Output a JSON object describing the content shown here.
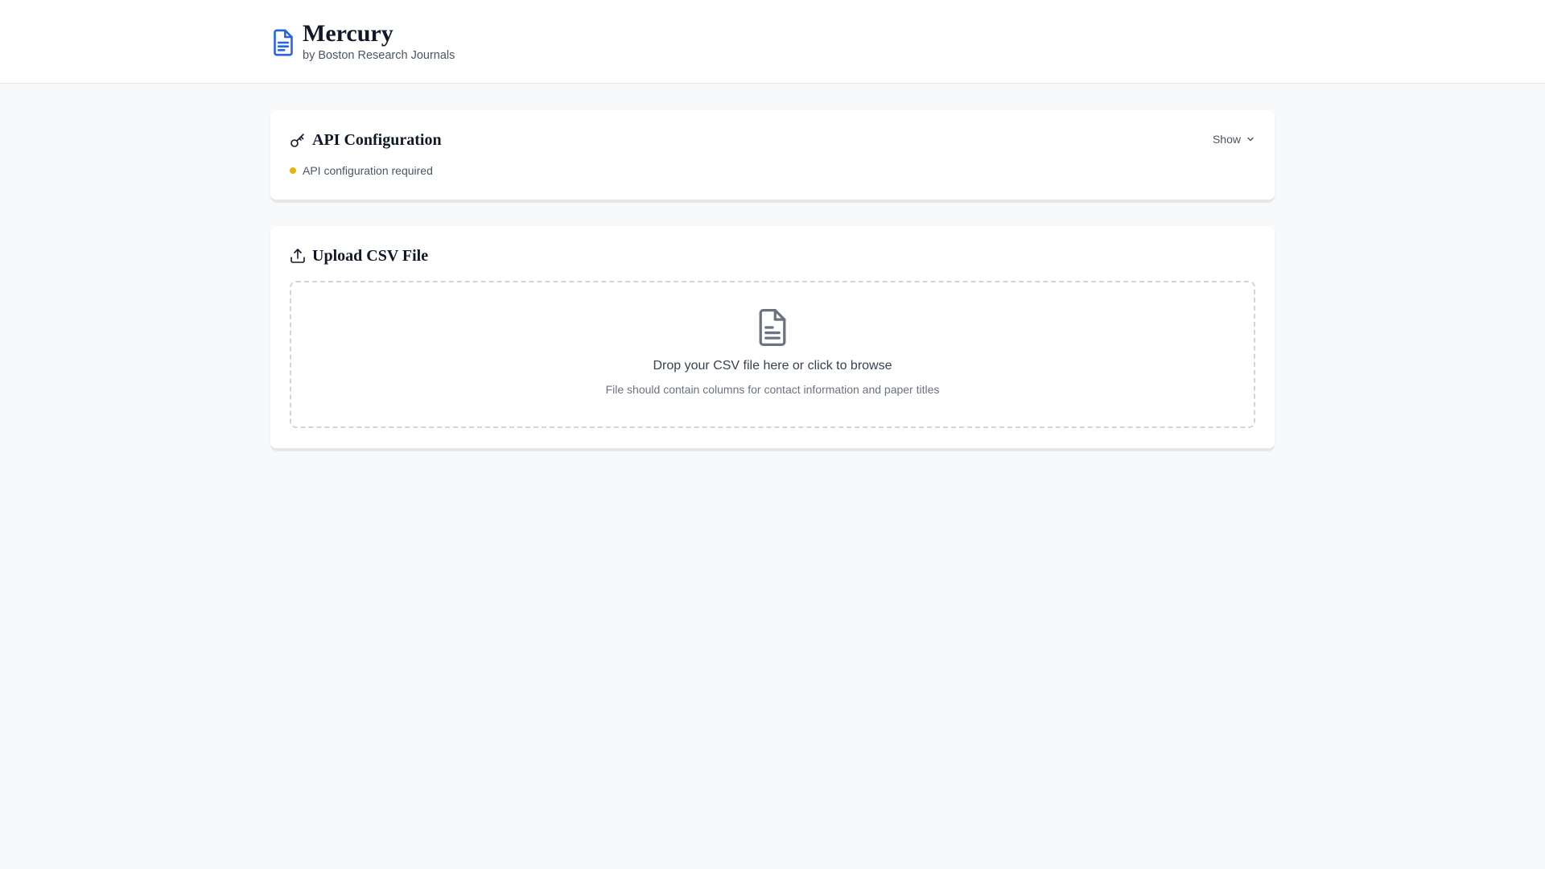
{
  "header": {
    "title": "Mercury",
    "subtitle": "by Boston Research Journals",
    "icon": "document-icon",
    "accent_color": "#2563eb"
  },
  "api_config": {
    "title": "API Configuration",
    "icon": "key-icon",
    "toggle_label": "Show",
    "status_text": "API configuration required",
    "status_color": "#eab308"
  },
  "upload": {
    "title": "Upload CSV File",
    "icon": "upload-icon",
    "dropzone_icon": "file-icon",
    "dropzone_text": "Drop your CSV file here or click to browse",
    "dropzone_hint": "File should contain columns for contact information and paper titles"
  }
}
